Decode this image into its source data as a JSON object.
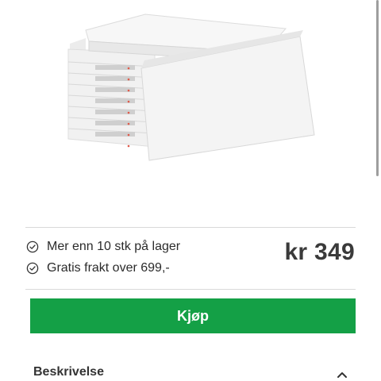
{
  "product": {
    "image_icon": "stacked-mattresses-image"
  },
  "stock": {
    "availability": "Mer enn 10 stk på lager",
    "shipping": "Gratis frakt over 699,-"
  },
  "price": {
    "label": "kr 349"
  },
  "actions": {
    "buy_label": "Kjøp"
  },
  "sections": {
    "description_title": "Beskrivelse"
  },
  "colors": {
    "accent_green": "#14a046"
  }
}
